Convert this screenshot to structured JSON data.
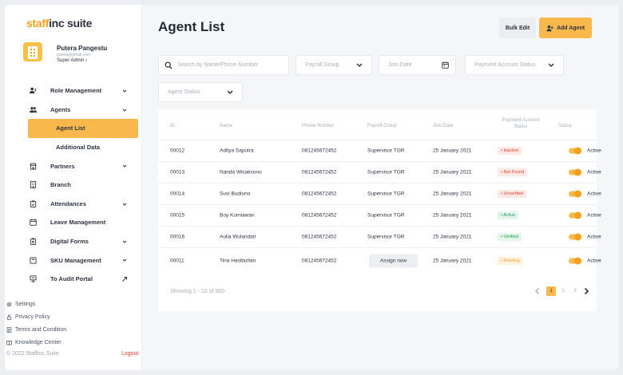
{
  "brand": {
    "part1": "staff",
    "part2": "inc suite"
  },
  "user": {
    "name": "Putera Pangestu",
    "email": "putera@gmail.com",
    "role": "Super Admin  ›"
  },
  "nav": [
    {
      "label": "Role Management",
      "icon": "role-icon",
      "chevron": true
    },
    {
      "label": "Agents",
      "icon": "agents-icon",
      "chevron": true
    },
    {
      "label": "Agent List",
      "active": true
    },
    {
      "label": "Additional Data",
      "sub": true
    },
    {
      "label": "Partners",
      "icon": "partners-icon",
      "chevron": true
    },
    {
      "label": "Branch",
      "icon": "branch-icon"
    },
    {
      "label": "Attendances",
      "icon": "attendance-icon",
      "chevron": true
    },
    {
      "label": "Leave Management",
      "icon": "calendar-icon"
    },
    {
      "label": "Digital Forms",
      "icon": "form-icon",
      "chevron": true
    },
    {
      "label": "SKU Management",
      "icon": "sku-icon",
      "chevron": true
    },
    {
      "label": "To Audit Portal",
      "icon": "audit-icon",
      "external": true
    }
  ],
  "footer_links": [
    {
      "label": "Settings",
      "icon": "gear-icon"
    },
    {
      "label": "Privacy Policy",
      "icon": "lock-icon"
    },
    {
      "label": "Terms and Condition",
      "icon": "document-icon"
    },
    {
      "label": "Knowledge Center",
      "icon": "book-icon"
    }
  ],
  "copyright": "© 2022 Staffinc Suite",
  "logout": "Logout",
  "page": {
    "title": "Agent List",
    "bulk_edit": "Bulk Edit",
    "add_agent": "Add Agent"
  },
  "filters": {
    "search_placeholder": "Search by Name/Phone Number",
    "payroll_group": "Payroll Group",
    "join_date": "Join Date",
    "payment_account_status": "Payment Account Status",
    "agent_status": "Agent Status"
  },
  "table": {
    "headers": [
      "ID",
      "Name",
      "Phone Number",
      "Payroll Group",
      "Join Date",
      "Payment Account Status",
      "Status"
    ],
    "rows": [
      {
        "id": "00012",
        "name": "Aditya Saputra",
        "phone": "081245672452",
        "payroll": "Supervisor TGR",
        "join": "25 January 2021",
        "payment": "• Inactive",
        "payment_color": "#e0432f",
        "payment_bg": "#fde8e6",
        "status": "Active"
      },
      {
        "id": "00013",
        "name": "Nanda Wicaksono",
        "phone": "081245672452",
        "payroll": "Supervisor TGR",
        "join": "25 January 2021",
        "payment": "• Not Found",
        "payment_color": "#e0432f",
        "payment_bg": "#fde8e6",
        "status": "Active"
      },
      {
        "id": "00014",
        "name": "Susi Budiono",
        "phone": "081245672452",
        "payroll": "Supervisor TGR",
        "join": "25 January 2021",
        "payment": "• Unverified",
        "payment_color": "#e0432f",
        "payment_bg": "#fde8e6",
        "status": "Active"
      },
      {
        "id": "00015",
        "name": "Boy Kurniawan",
        "phone": "081245672452",
        "payroll": "Supervisor TGR",
        "join": "25 January 2021",
        "payment": "• Active",
        "payment_color": "#1f9d55",
        "payment_bg": "#e3f6ea",
        "status": "Active"
      },
      {
        "id": "00016",
        "name": "Aulia Wulandari",
        "phone": "081245672452",
        "payroll": "Supervisor TGR",
        "join": "25 January 2021",
        "payment": "• Verified",
        "payment_color": "#1f9d55",
        "payment_bg": "#e3f6ea",
        "status": "Active"
      },
      {
        "id": "00011",
        "name": "Tina Hasibuhan",
        "phone": "081245672452",
        "payroll": "",
        "assign": "Assign now",
        "join": "25 January 2021",
        "payment": "• Pending",
        "payment_color": "#f3a11f",
        "payment_bg": "#fff2de",
        "status": "Active"
      }
    ]
  },
  "pagination": {
    "showing": "Showing 1 - 10 of 800",
    "pages": [
      "1",
      "2",
      "3"
    ],
    "current": "1"
  },
  "colors": {
    "accent": "#f8b84b",
    "accent_dark": "#f3a11f"
  }
}
